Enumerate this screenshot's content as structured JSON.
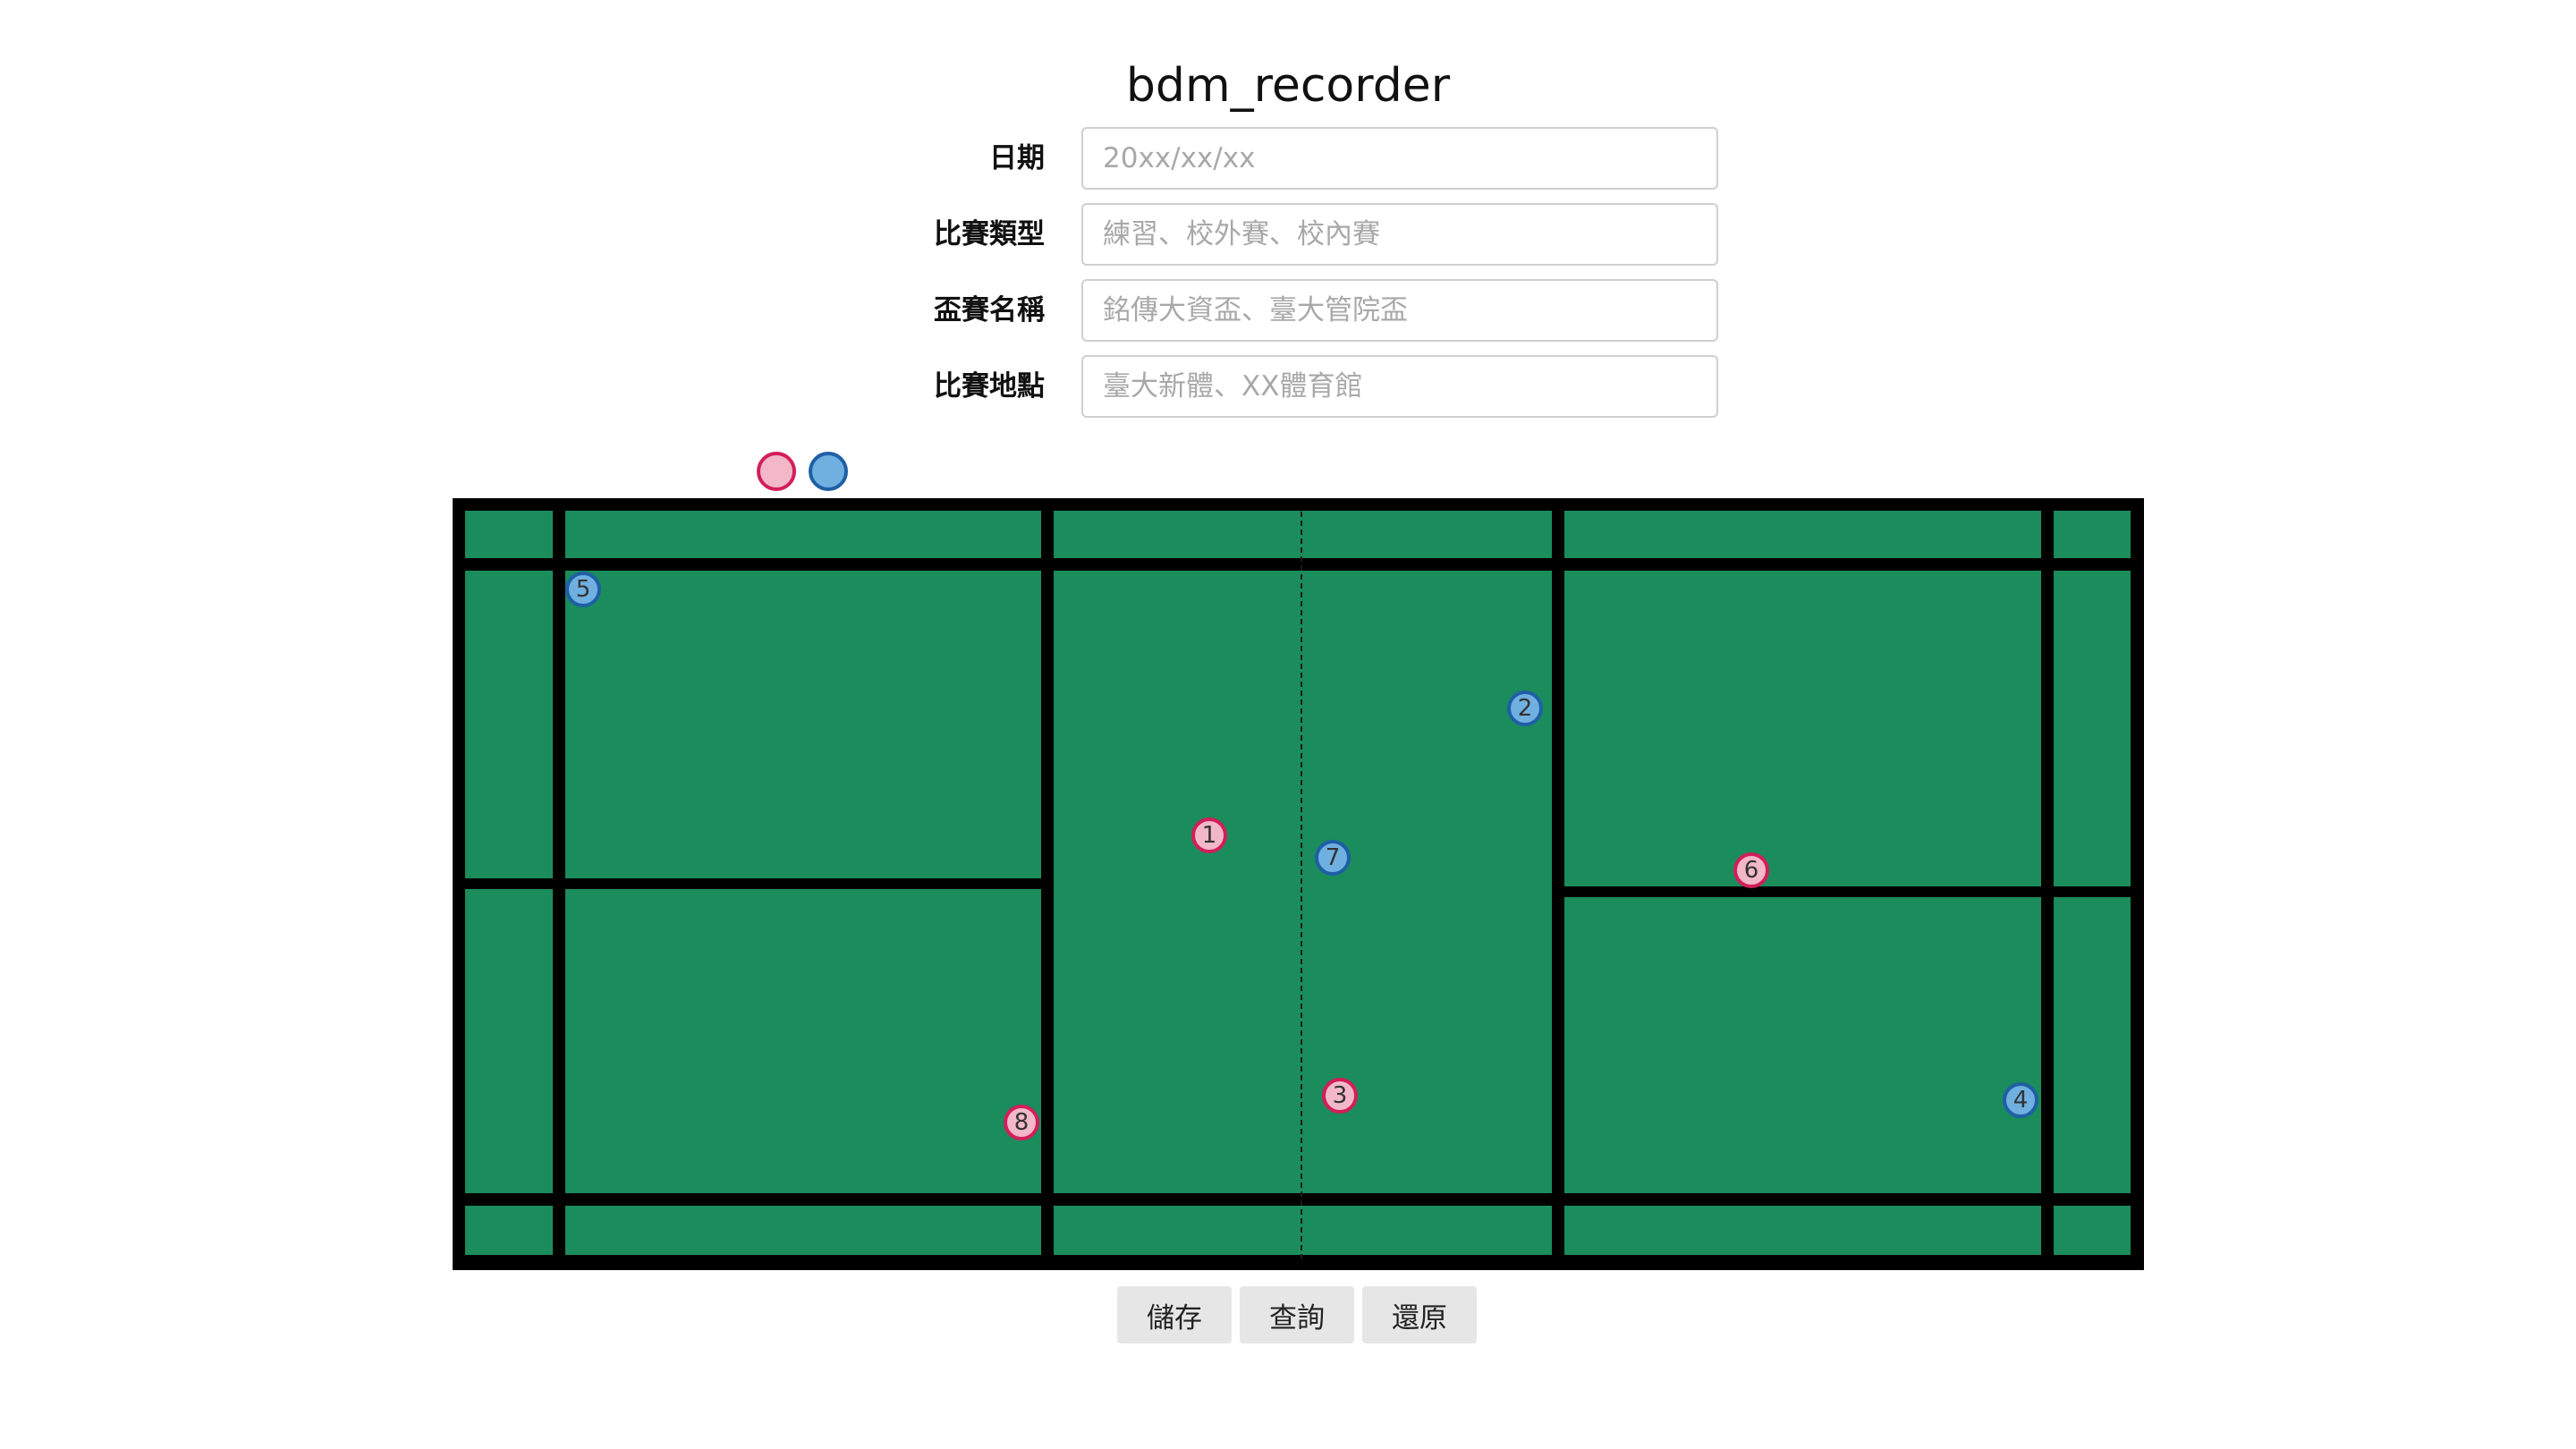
{
  "app": {
    "title": "bdm_recorder"
  },
  "form": {
    "fields": [
      {
        "label": "日期",
        "value": "",
        "placeholder": "20xx/xx/xx"
      },
      {
        "label": "比賽類型",
        "value": "",
        "placeholder": "練習、校外賽、校內賽"
      },
      {
        "label": "盃賽名稱",
        "value": "",
        "placeholder": "銘傳大資盃、臺大管院盃"
      },
      {
        "label": "比賽地點",
        "value": "",
        "placeholder": "臺大新體、XX體育館"
      }
    ]
  },
  "legend": {
    "red": {
      "fill": "#f2b8c8",
      "border": "#d21e5a"
    },
    "blue": {
      "fill": "#6fb0e0",
      "border": "#1f5fa5"
    }
  },
  "court": {
    "surface_color": "#1b8c5c",
    "line_color": "#000000",
    "markers": [
      {
        "label": "1",
        "team": "red"
      },
      {
        "label": "2",
        "team": "blue"
      },
      {
        "label": "3",
        "team": "red"
      },
      {
        "label": "4",
        "team": "blue"
      },
      {
        "label": "5",
        "team": "blue"
      },
      {
        "label": "6",
        "team": "red"
      },
      {
        "label": "7",
        "team": "blue"
      },
      {
        "label": "8",
        "team": "red"
      }
    ]
  },
  "buttons": {
    "save": "儲存",
    "query": "查詢",
    "restore": "還原"
  }
}
